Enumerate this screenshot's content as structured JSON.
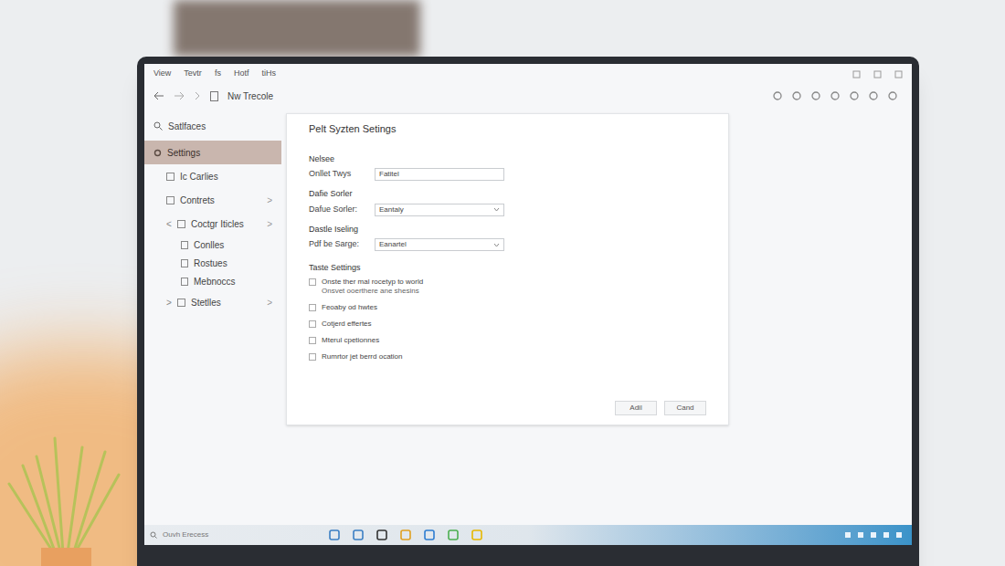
{
  "menu": [
    "View",
    "Tevtr",
    "fs",
    "Hotf",
    "tiHs"
  ],
  "toolbar": {
    "path": "Nw Trecole"
  },
  "sidebar": {
    "search": "Satlfaces",
    "items": [
      {
        "label": "Settings",
        "selected": true
      },
      {
        "label": "Ic Carlies",
        "selected": false
      },
      {
        "label": "Contrets",
        "selected": false,
        "chevron": ">"
      },
      {
        "label": "Coctgr Iticles",
        "selected": false,
        "expanded": true,
        "chevron": ">",
        "prefix": "<",
        "children": [
          {
            "label": "Conlles",
            "selected": false
          },
          {
            "label": "Rostues",
            "selected": false
          },
          {
            "label": "Mebnoccs",
            "selected": false
          }
        ]
      },
      {
        "label": "Stetlles",
        "selected": false,
        "expanded": false,
        "chevron": ">",
        "prefix": ">"
      }
    ]
  },
  "panel": {
    "title": "Pelt Syzten Setings",
    "fields": [
      {
        "heading": "Nelsee",
        "label": "Onllet Twys",
        "kind": "text",
        "value": "Fatitel"
      },
      {
        "heading": "Dafie Sorler",
        "label": "Dafue Sorler:",
        "kind": "select",
        "value": "Eantaly"
      },
      {
        "heading": "Dastle Iseling",
        "label": "Pdf be Sarge:",
        "kind": "select",
        "value": "Eanartel"
      }
    ],
    "checks_heading": "Taste Settings",
    "checks": [
      {
        "label": "Onste ther mal rocetyp to world",
        "sublabel": "Onsvet ooerthere ane shesins",
        "checked": false
      },
      {
        "label": "Feoaby od hwtes",
        "checked": false
      },
      {
        "label": "Cotjerd effertes",
        "checked": false
      },
      {
        "label": "Mterul cpetionnes",
        "checked": false
      },
      {
        "label": "Rumrtor jet berrd ocation",
        "checked": false
      }
    ],
    "buttons": [
      "Adil",
      "Cand"
    ]
  },
  "taskbar": {
    "search": "Ouvh Erecess"
  }
}
